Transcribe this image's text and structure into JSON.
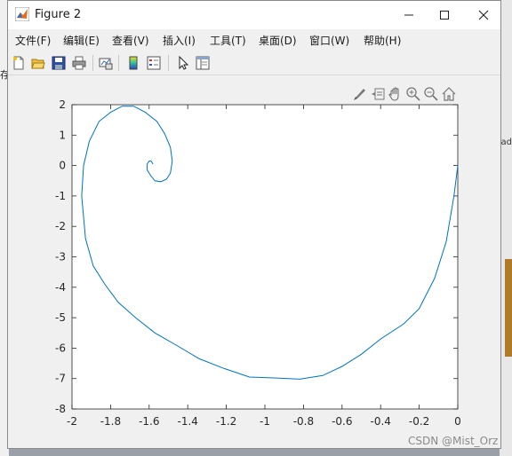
{
  "window": {
    "title": "Figure 2"
  },
  "menu": {
    "items": [
      {
        "label": "文件(F)"
      },
      {
        "label": "编辑(E)"
      },
      {
        "label": "查看(V)"
      },
      {
        "label": "插入(I)"
      },
      {
        "label": "工具(T)"
      },
      {
        "label": "桌面(D)"
      },
      {
        "label": "窗口(W)"
      },
      {
        "label": "帮助(H)"
      }
    ]
  },
  "toolbar": {
    "icons": [
      "new-figure-icon",
      "open-file-icon",
      "save-icon",
      "print-icon",
      "link-plot-icon",
      "colorbar-icon",
      "legend-icon",
      "edit-plot-icon",
      "property-inspector-icon"
    ]
  },
  "axes_toolbar": {
    "icons": [
      "brush-icon",
      "data-tips-icon",
      "pan-icon",
      "zoom-in-icon",
      "zoom-out-icon",
      "home-icon"
    ]
  },
  "background": {
    "left_text": "存",
    "right_text": "ad"
  },
  "watermark": "CSDN @Mist_Orz",
  "chart_data": {
    "type": "line",
    "xlim": [
      -2,
      0
    ],
    "ylim": [
      -8,
      2
    ],
    "x_ticks": [
      "-2",
      "-1.8",
      "-1.6",
      "-1.4",
      "-1.2",
      "-1",
      "-0.8",
      "-0.6",
      "-0.4",
      "-0.2",
      "0"
    ],
    "y_ticks": [
      "2",
      "1",
      "0",
      "-1",
      "-2",
      "-3",
      "-4",
      "-5",
      "-6",
      "-7",
      "-8"
    ],
    "line_color": "#0072bd",
    "series": [
      {
        "x": [
          0.0,
          -0.02,
          -0.06,
          -0.12,
          -0.2,
          -0.28,
          -0.4,
          -0.5,
          -0.6,
          -0.7,
          -0.82,
          -0.95,
          -1.08,
          -1.22,
          -1.34,
          -1.46,
          -1.57,
          -1.67,
          -1.76,
          -1.83,
          -1.89,
          -1.93,
          -1.95,
          -1.94,
          -1.91,
          -1.86,
          -1.8,
          -1.74,
          -1.68,
          -1.62,
          -1.56,
          -1.52,
          -1.49,
          -1.48,
          -1.49,
          -1.51,
          -1.54,
          -1.57,
          -1.59,
          -1.61,
          -1.61,
          -1.6,
          -1.59,
          -1.58
        ],
        "y": [
          0.0,
          -1.0,
          -2.5,
          -3.7,
          -4.7,
          -5.2,
          -5.7,
          -6.2,
          -6.6,
          -6.9,
          -7.02,
          -6.98,
          -6.95,
          -6.65,
          -6.35,
          -5.9,
          -5.5,
          -5.0,
          -4.5,
          -3.9,
          -3.3,
          -2.4,
          -1.0,
          0.0,
          0.8,
          1.45,
          1.75,
          1.95,
          1.95,
          1.75,
          1.45,
          1.05,
          0.6,
          0.15,
          -0.25,
          -0.45,
          -0.53,
          -0.5,
          -0.35,
          -0.15,
          0.05,
          0.15,
          0.15,
          0.05
        ]
      }
    ]
  }
}
